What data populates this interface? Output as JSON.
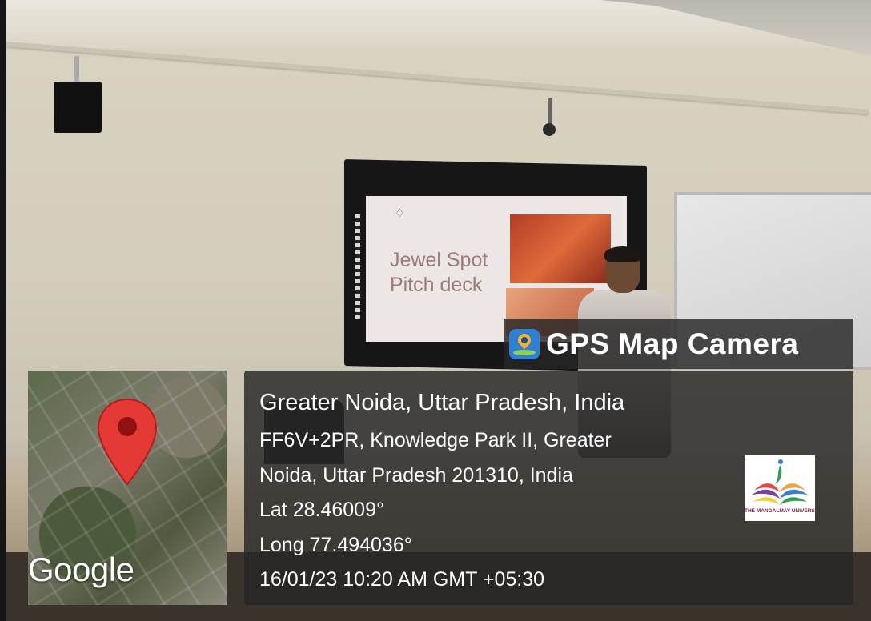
{
  "slide": {
    "title_line1": "Jewel Spot",
    "title_line2": "Pitch deck"
  },
  "overlay": {
    "app_name": "GPS Map Camera",
    "app_icon": "gps-map-camera-icon",
    "map_provider": "Google",
    "location_title": "Greater Noida, Uttar Pradesh, India",
    "address_line1": "FF6V+2PR, Knowledge Park II, Greater",
    "address_line2": "Noida, Uttar Pradesh 201310, India",
    "latitude": "Lat 28.46009°",
    "longitude": "Long 77.494036°",
    "timestamp": "16/01/23 10:20 AM GMT +05:30",
    "logo_text": "THE MANGALMAY UNIVERSITY",
    "pin_color": "#e53935",
    "panel_color": "#262626"
  }
}
